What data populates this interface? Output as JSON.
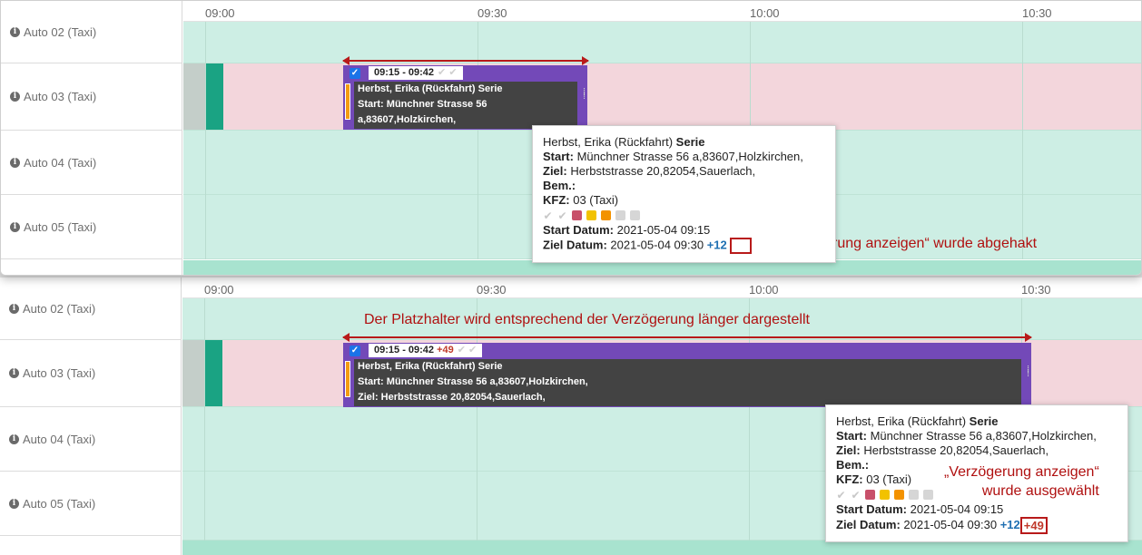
{
  "time_ticks": [
    "09:00",
    "09:30",
    "10:00",
    "10:30"
  ],
  "rows": [
    "Auto 02 (Taxi)",
    "Auto 03 (Taxi)",
    "Auto 04 (Taxi)",
    "Auto 05 (Taxi)"
  ],
  "colors": {
    "booking": "#7349b8",
    "lane_free": "#cdeee4",
    "lane_busy": "#f3d6dc",
    "annotation": "#b81a1a",
    "plus": "#1f6fb2"
  },
  "top": {
    "booking": {
      "time": "09:15 - 09:42",
      "checks": "✔ ✔",
      "line1": "Herbst, Erika (Rückfahrt) Serie",
      "line2": "Start: Münchner Strasse 56",
      "line3": "a,83607,Holzkirchen,"
    },
    "tooltip": {
      "name": "Herbst, Erika (Rückfahrt)",
      "serie": "Serie",
      "start_label": "Start:",
      "start_value": "Münchner Strasse 56 a,83607,Holzkirchen,",
      "ziel_label": "Ziel:",
      "ziel_value": "Herbststrasse 20,82054,Sauerlach,",
      "bem_label": "Bem.:",
      "kfz_label": "KFZ:",
      "kfz_value": "03 (Taxi)",
      "start_datum_label": "Start Datum:",
      "start_datum_value": "2021-05-04 09:15",
      "ziel_datum_label": "Ziel Datum:",
      "ziel_datum_value": "2021-05-04 09:30",
      "plus": "+12"
    },
    "annotation": "„Verzögerung anzeigen“ wurde abgehakt"
  },
  "bottom": {
    "headline": "Der Platzhalter wird entsprechend der Verzögerung länger dargestellt",
    "booking": {
      "time": "09:15 - 09:42",
      "delay": "+49",
      "checks": "✔ ✔",
      "line1": "Herbst, Erika (Rückfahrt) Serie",
      "line2": "Start: Münchner Strasse 56 a,83607,Holzkirchen,",
      "line3": "Ziel: Herbststrasse 20,82054,Sauerlach,"
    },
    "tooltip": {
      "name": "Herbst, Erika (Rückfahrt)",
      "serie": "Serie",
      "start_label": "Start:",
      "start_value": "Münchner Strasse 56 a,83607,Holzkirchen,",
      "ziel_label": "Ziel:",
      "ziel_value": "Herbststrasse 20,82054,Sauerlach,",
      "bem_label": "Bem.:",
      "kfz_label": "KFZ:",
      "kfz_value": "03 (Taxi)",
      "start_datum_label": "Start Datum:",
      "start_datum_value": "2021-05-04 09:15",
      "ziel_datum_label": "Ziel Datum:",
      "ziel_datum_value": "2021-05-04 09:30",
      "plus": "+12",
      "delay": "+49"
    },
    "annotation_line1": "„Verzögerung anzeigen“",
    "annotation_line2": "wurde ausgewählt"
  }
}
